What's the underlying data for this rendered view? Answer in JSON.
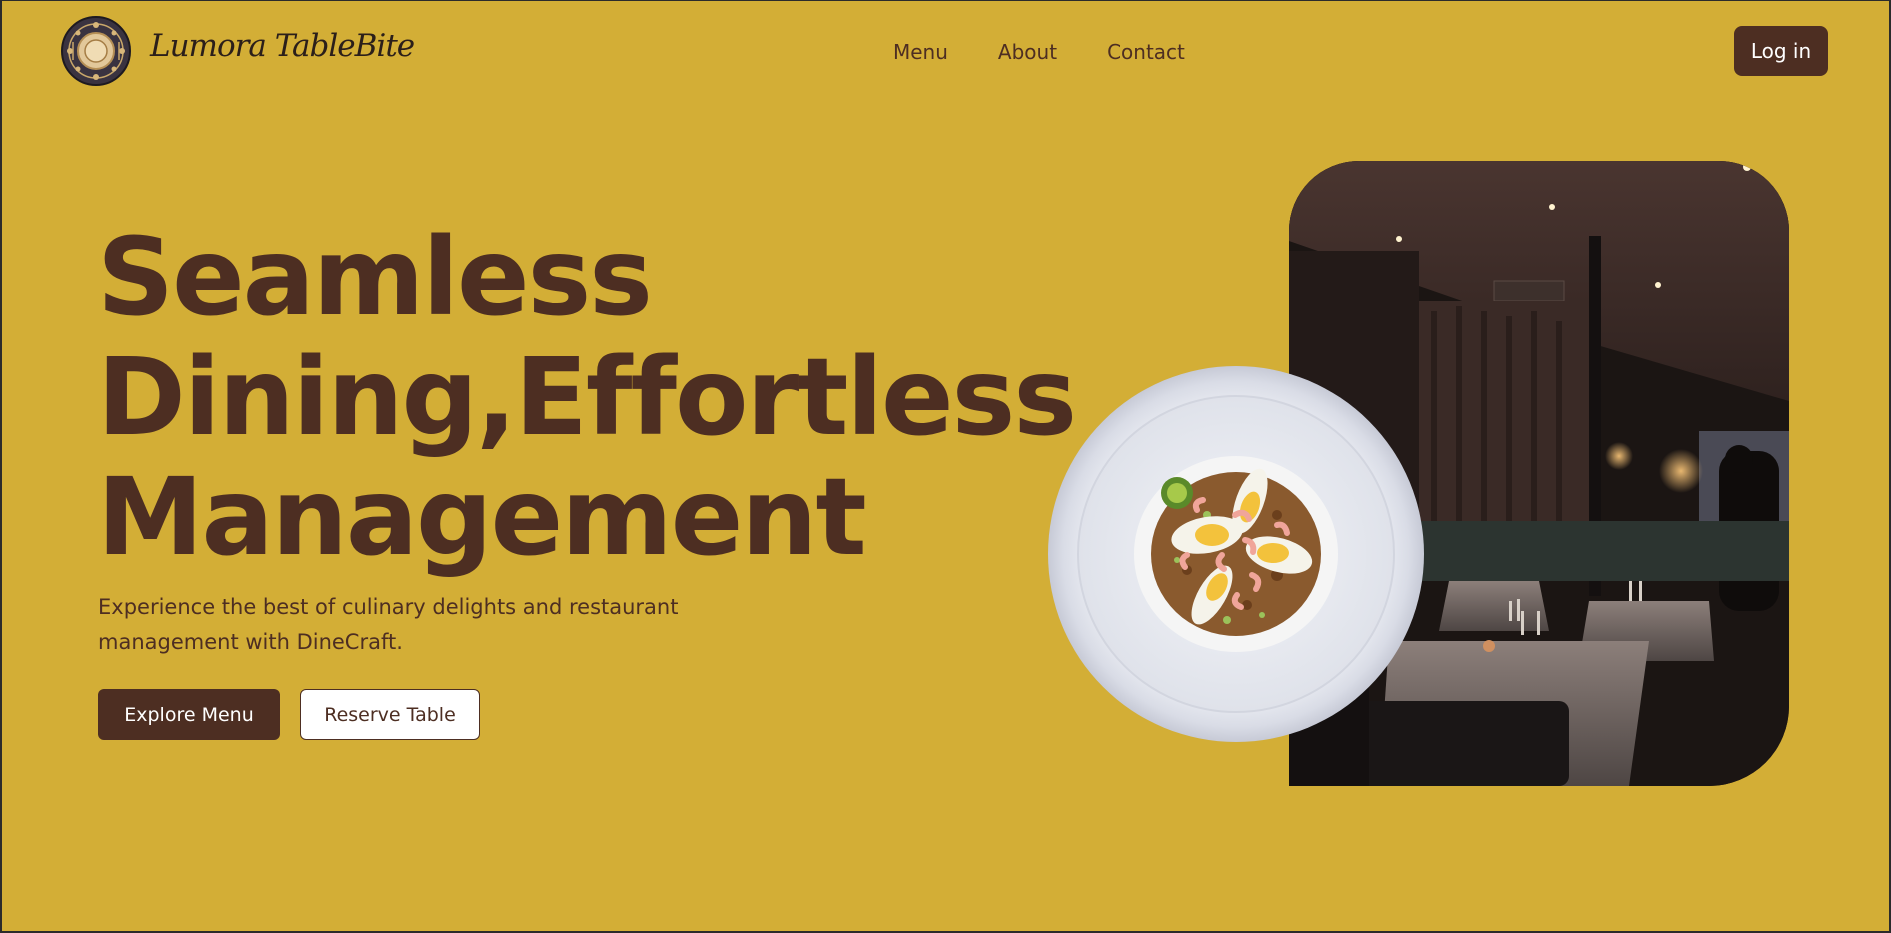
{
  "brand": {
    "name": "Lumora TableBite",
    "logo_icon": "restaurant-logo-icon"
  },
  "nav": {
    "items": [
      {
        "label": "Menu"
      },
      {
        "label": "About"
      },
      {
        "label": "Contact"
      }
    ],
    "login_label": "Log in"
  },
  "hero": {
    "title_line1": "Seamless",
    "title_line2": "Dining,Effortless",
    "title_line3": "Management",
    "subtitle": "Experience the best of culinary delights and restaurant management with DineCraft.",
    "primary_button": "Explore Menu",
    "secondary_button": "Reserve Table"
  },
  "colors": {
    "background": "#d3ae36",
    "accent": "#4d2e22",
    "button_text": "#ffffff"
  }
}
